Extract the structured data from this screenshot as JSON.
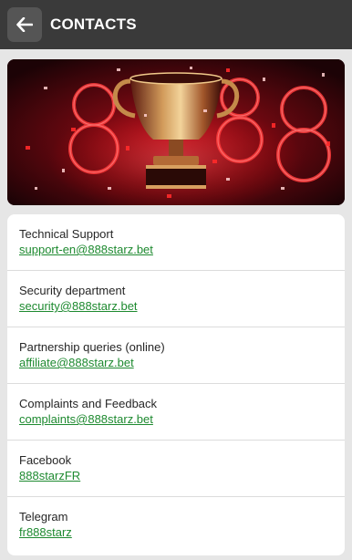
{
  "header": {
    "title": "CONTACTS",
    "back_icon": "arrow-left-icon"
  },
  "banner": {
    "image": "trophy-888-banner"
  },
  "contacts": [
    {
      "label": "Technical Support",
      "value": "support-en@888starz.bet"
    },
    {
      "label": "Security department",
      "value": "security@888starz.bet"
    },
    {
      "label": "Partnership queries (online)",
      "value": "affiliate@888starz.bet"
    },
    {
      "label": "Complaints and Feedback",
      "value": "complaints@888starz.bet"
    },
    {
      "label": "Facebook",
      "value": "888starzFR"
    },
    {
      "label": "Telegram",
      "value": "fr888starz"
    }
  ],
  "colors": {
    "header_bg": "#3a3a3a",
    "link": "#1e8a30",
    "page_bg": "#e6e6e6"
  }
}
